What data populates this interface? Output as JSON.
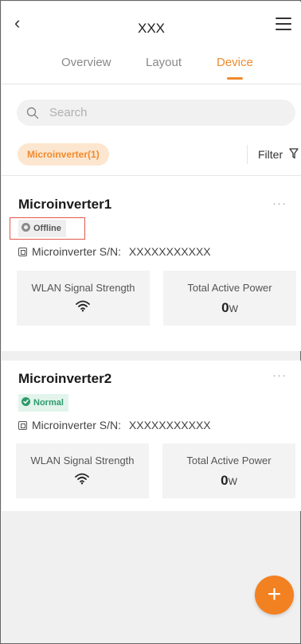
{
  "header": {
    "back_icon": "chevron-left-icon",
    "title": "XXX",
    "menu_icon": "hamburger-menu-icon"
  },
  "tabs": [
    {
      "label": "Overview",
      "active": false
    },
    {
      "label": "Layout",
      "active": false
    },
    {
      "label": "Device",
      "active": true
    }
  ],
  "search": {
    "placeholder": "Search",
    "icon": "search-icon"
  },
  "filters": {
    "chip_label": "Microinverter(1)",
    "filter_label": "Filter",
    "filter_icon": "funnel-icon"
  },
  "devices": [
    {
      "name": "Microinverter1",
      "status": "Offline",
      "sn_label": "Microinverter S/N:",
      "sn_value": "XXXXXXXXXXX",
      "wlan_label": "WLAN Signal Strength",
      "power_label": "Total Active Power",
      "power_value": "0",
      "power_unit": "W"
    },
    {
      "name": "Microinverter2",
      "status": "Normal",
      "sn_label": "Microinverter S/N:",
      "sn_value": "XXXXXXXXXXX",
      "wlan_label": "WLAN Signal Strength",
      "power_label": "Total Active Power",
      "power_value": "0",
      "power_unit": "W"
    }
  ],
  "fab": {
    "label": "+"
  },
  "colors": {
    "accent": "#f08a2c",
    "offline": "#555555",
    "normal": "#2e9a6a",
    "highlight": "#e0584c"
  }
}
